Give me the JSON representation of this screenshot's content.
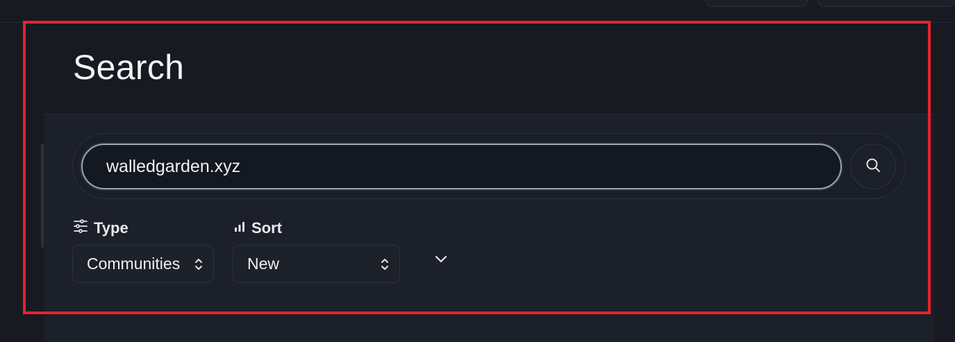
{
  "page": {
    "title": "Search"
  },
  "search": {
    "value": "walledgarden.xyz",
    "button_icon": "search-icon"
  },
  "filters": {
    "type": {
      "label": "Type",
      "icon": "sliders-icon",
      "selected": "Communities"
    },
    "sort": {
      "label": "Sort",
      "icon": "bar-chart-icon",
      "selected": "New"
    },
    "expand_icon": "chevron-down-icon"
  },
  "colors": {
    "background": "#171a21",
    "panel": "#1c202a",
    "highlight": "#e8232b"
  }
}
